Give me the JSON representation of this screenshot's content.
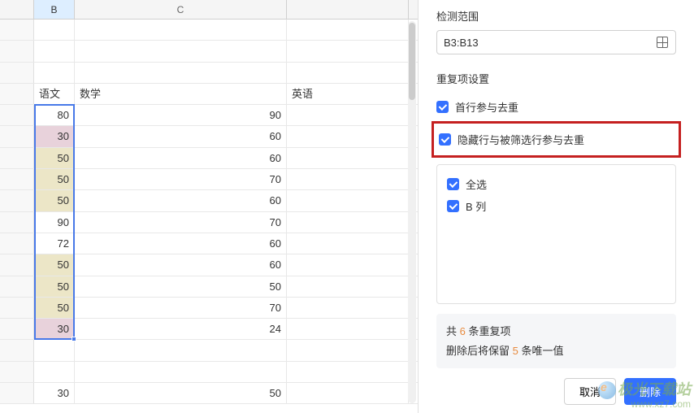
{
  "columns": {
    "b": "B",
    "c": "C",
    "d": ""
  },
  "header_row": {
    "b": "语文",
    "c": "数学",
    "d": "英语"
  },
  "rows": [
    {
      "b": "80",
      "c": "90",
      "highlight": null
    },
    {
      "b": "30",
      "c": "60",
      "highlight": "pink"
    },
    {
      "b": "50",
      "c": "60",
      "highlight": "yellow"
    },
    {
      "b": "50",
      "c": "70",
      "highlight": "yellow"
    },
    {
      "b": "50",
      "c": "60",
      "highlight": "yellow"
    },
    {
      "b": "90",
      "c": "70",
      "highlight": null
    },
    {
      "b": "72",
      "c": "60",
      "highlight": null
    },
    {
      "b": "50",
      "c": "60",
      "highlight": "yellow"
    },
    {
      "b": "50",
      "c": "50",
      "highlight": "yellow"
    },
    {
      "b": "50",
      "c": "70",
      "highlight": "yellow"
    },
    {
      "b": "30",
      "c": "24",
      "highlight": "pink"
    }
  ],
  "extra_rows": [
    {
      "b": "",
      "c": ""
    },
    {
      "b": "",
      "c": ""
    },
    {
      "b": "30",
      "c": "50"
    }
  ],
  "panel": {
    "range_label": "检测范围",
    "range_value": "B3:B13",
    "settings_label": "重复项设置",
    "opt_first_row": "首行参与去重",
    "opt_hidden_rows": "隐藏行与被筛选行参与去重",
    "opt_select_all": "全选",
    "opt_col_b": "B 列",
    "summary_prefix": "共 ",
    "summary_count": "6",
    "summary_suffix": " 条重复项",
    "summary2_prefix": "删除后将保留 ",
    "summary2_count": "5",
    "summary2_suffix": " 条唯一值",
    "btn_cancel": "取消",
    "btn_delete": "删除"
  },
  "watermark": {
    "line1": "极光下载站",
    "line2": "www.xz7.com"
  }
}
